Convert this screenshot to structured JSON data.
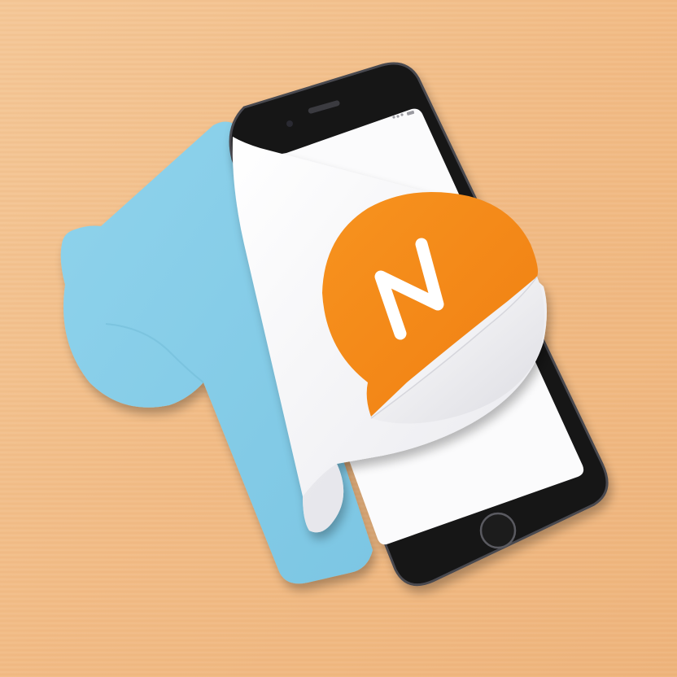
{
  "scene": {
    "description_alt": "",
    "logo": {
      "letter": "N",
      "bubble_color": "#F5891F",
      "letter_color": "#FFFFFF"
    },
    "colors": {
      "table": "#F2BE8A",
      "blue_card": "#86CDE8",
      "paper": "#F4F4F6",
      "phone_body": "#141416",
      "screen": "#FBFBFC"
    },
    "icons": [
      "phone-icon",
      "home-button-icon",
      "speech-bubble-icon"
    ]
  }
}
